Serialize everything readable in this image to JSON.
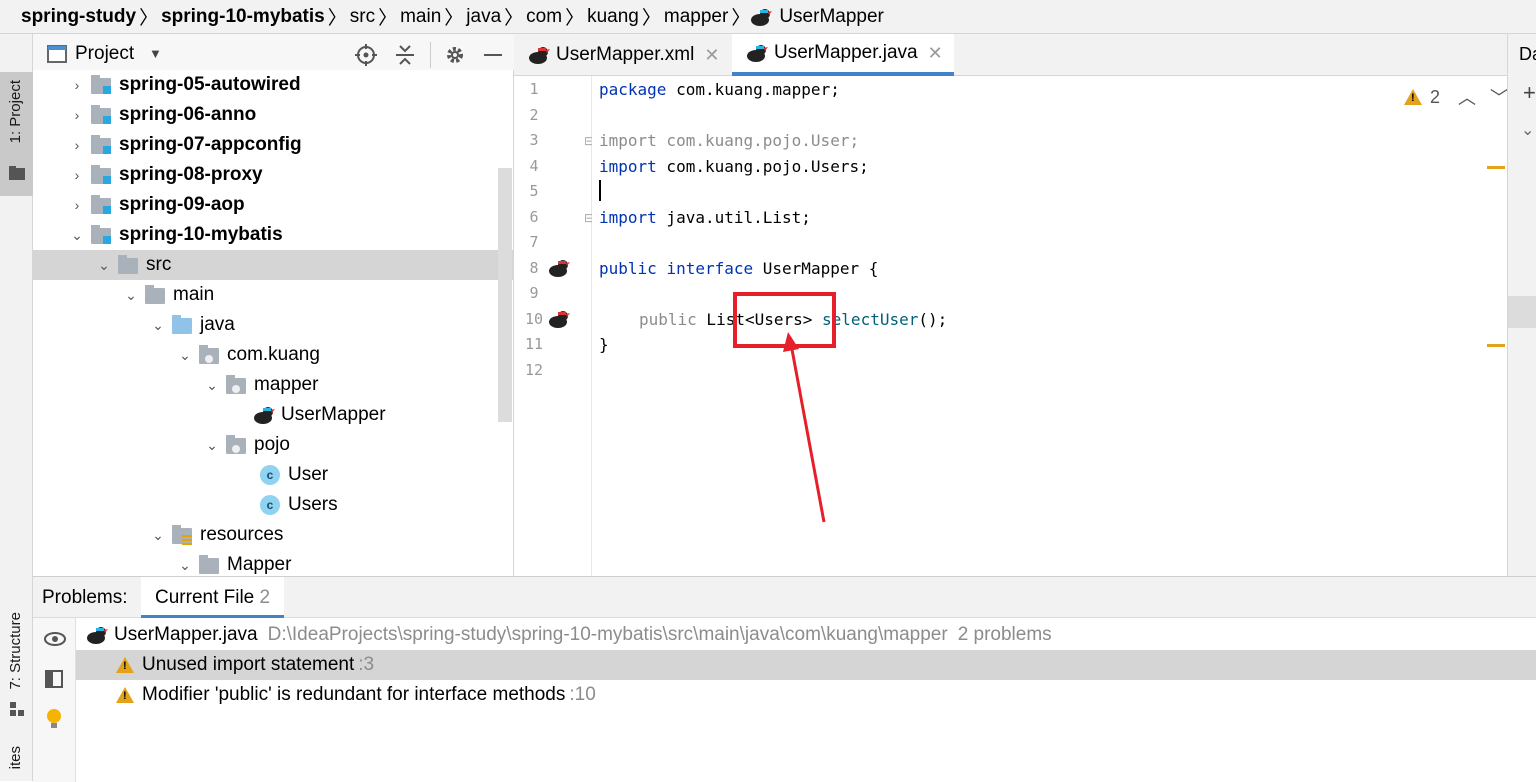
{
  "breadcrumb": {
    "items": [
      {
        "label": "spring-study",
        "bold": true
      },
      {
        "label": "spring-10-mybatis",
        "bold": true
      },
      {
        "label": "src"
      },
      {
        "label": "main"
      },
      {
        "label": "java"
      },
      {
        "label": "com"
      },
      {
        "label": "kuang"
      },
      {
        "label": "mapper"
      },
      {
        "label": "UserMapper",
        "icon": "mybatis-bird-icon"
      }
    ]
  },
  "left_strip": {
    "project_label": "1: Project",
    "structure_label": "7: Structure",
    "favorites_label": "ites"
  },
  "project_panel": {
    "title": "Project"
  },
  "tree": [
    {
      "label": "spring-05-autowired",
      "bold": true
    },
    {
      "label": "spring-06-anno",
      "bold": true
    },
    {
      "label": "spring-07-appconfig",
      "bold": true
    },
    {
      "label": "spring-08-proxy",
      "bold": true
    },
    {
      "label": "spring-09-aop",
      "bold": true
    },
    {
      "label": "spring-10-mybatis",
      "bold": true
    },
    {
      "label": "src"
    },
    {
      "label": "main"
    },
    {
      "label": "java"
    },
    {
      "label": "com.kuang"
    },
    {
      "label": "mapper"
    },
    {
      "label": "UserMapper"
    },
    {
      "label": "pojo"
    },
    {
      "label": "User"
    },
    {
      "label": "Users"
    },
    {
      "label": "resources"
    },
    {
      "label": "Mapper"
    }
  ],
  "editor": {
    "tabs": [
      {
        "label": "UserMapper.xml"
      },
      {
        "label": "UserMapper.java"
      }
    ],
    "warning_count": "2",
    "right_strip_label": "Da",
    "line_numbers": [
      "1",
      "2",
      "3",
      "4",
      "5",
      "6",
      "7",
      "8",
      "9",
      "10",
      "11",
      "12"
    ],
    "code": {
      "l1_kw": "package",
      "l1_rest": " com.kuang.mapper;",
      "l3": "import com.kuang.pojo.User;",
      "l4_kw": "import",
      "l4_rest": " com.kuang.pojo.Users;",
      "l6_kw": "import",
      "l6_rest": " java.util.List;",
      "l8_kw1": "public",
      "l8_kw2": "interface",
      "l8_rest": " UserMapper {",
      "l10_mod": "public",
      "l10_type": " List<Users> ",
      "l10_method": "selectUser",
      "l10_rest": "();",
      "l11": "}"
    }
  },
  "problems": {
    "label": "Problems:",
    "tab_label": "Current File",
    "tab_count": "2",
    "file": {
      "name": "UserMapper.java",
      "path": "D:\\IdeaProjects\\spring-study\\spring-10-mybatis\\src\\main\\java\\com\\kuang\\mapper",
      "count": "2 problems"
    },
    "items": [
      {
        "text": "Unused import statement",
        "loc": ":3"
      },
      {
        "text": "Modifier 'public' is redundant for interface methods",
        "loc": ":10"
      }
    ]
  },
  "colors": {
    "annotation_red": "#e5202b",
    "accent_blue": "#4083c9",
    "warning": "#e3a21a"
  }
}
